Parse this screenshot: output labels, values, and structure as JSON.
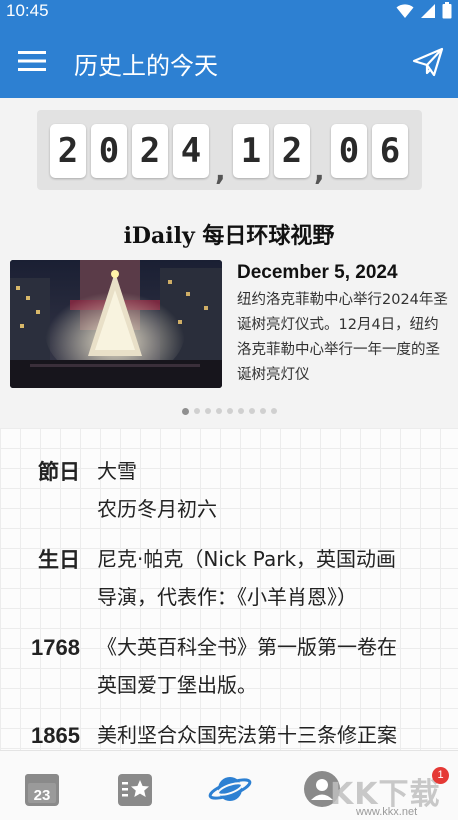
{
  "status_bar": {
    "time": "10:45"
  },
  "app_bar": {
    "title": "历史上的今天",
    "menu_icon": "hamburger-menu-icon",
    "send_icon": "paper-plane-icon"
  },
  "date_counter": {
    "digits": [
      "2",
      "0",
      "2",
      "4",
      "1",
      "2",
      "0",
      "6"
    ],
    "separator": ","
  },
  "brand": {
    "text": "iDaily 每日环球视野"
  },
  "featured": {
    "date": "December 5, 2024",
    "text": "纽约洛克菲勒中心举行2024年圣诞树亮灯仪式。12月4日，纽约洛克菲勒中心举行一年一度的圣诞树亮灯仪"
  },
  "carousel": {
    "total": 9,
    "active_index": 0
  },
  "entries": [
    {
      "label": "節日",
      "lines": [
        "大雪",
        "农历冬月初六"
      ]
    },
    {
      "label": "生日",
      "lines": [
        "尼克·帕克（Nick Park，英国动画",
        "导演，代表作：《小羊肖恩》）"
      ]
    },
    {
      "label": "1768",
      "lines": [
        "《大英百科全书》第一版第一卷在",
        "英国爱丁堡出版。"
      ]
    },
    {
      "label": "1865",
      "lines": [
        "美利坚合众国宪法第十三条修正案"
      ]
    }
  ],
  "bottom_nav": {
    "items": [
      "calendar-icon",
      "favorites-icon",
      "planet-icon",
      "profile-icon"
    ],
    "calendar_day": "23",
    "badge_count": "1",
    "watermark": "KK下载",
    "watermark_url": "www.kkx.net"
  },
  "colors": {
    "primary": "#2d80d2",
    "accent_planet": "#2d80d2"
  }
}
